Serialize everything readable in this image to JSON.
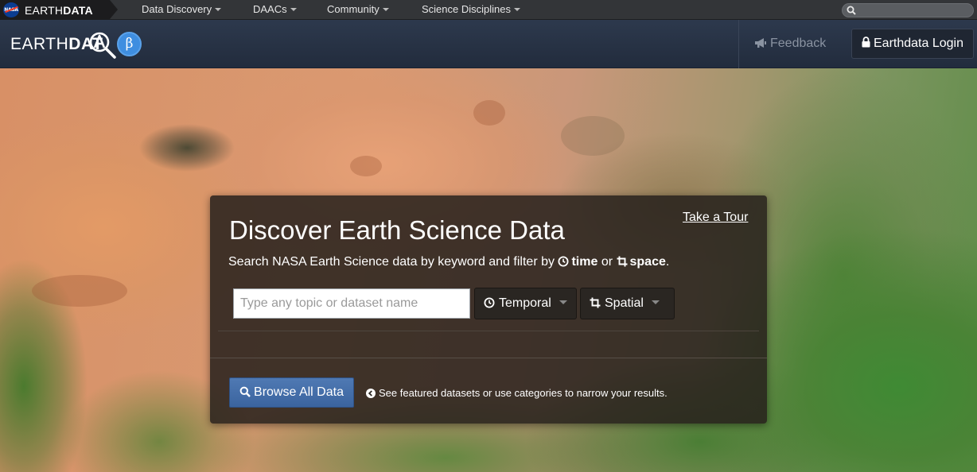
{
  "topbar": {
    "brand_light": "EARTH",
    "brand_bold": "DATA",
    "nasa_badge": "NASA",
    "nav": [
      {
        "label": "Data Discovery"
      },
      {
        "label": "DAACs"
      },
      {
        "label": "Community"
      },
      {
        "label": "Science Disciplines"
      }
    ],
    "search_placeholder": ""
  },
  "header": {
    "logo_light": "EARTH",
    "logo_bold": "DAT",
    "beta_label": "β",
    "feedback_label": "Feedback",
    "login_label": "Earthdata Login"
  },
  "panel": {
    "title": "Discover Earth Science Data",
    "tour_label": "Take a Tour",
    "subtitle_prefix": "Search NASA Earth Science data by keyword and filter by",
    "subtitle_time": "time",
    "subtitle_or": "or",
    "subtitle_space": "space",
    "subtitle_end": ".",
    "search_placeholder": "Type any topic or dataset name",
    "temporal_label": "Temporal",
    "spatial_label": "Spatial",
    "browse_label": "Browse All Data",
    "hint": "See featured datasets or use categories to narrow your results."
  },
  "colors": {
    "header_bg": "#263144",
    "topbar_bg": "#333538",
    "beta_blue": "#3f8ee0",
    "browse_blue": "#4570ab"
  },
  "icons": [
    "search-icon",
    "megaphone-icon",
    "lock-icon",
    "clock-icon",
    "crop-icon",
    "caret-down-icon",
    "arrow-circle-left-icon"
  ]
}
